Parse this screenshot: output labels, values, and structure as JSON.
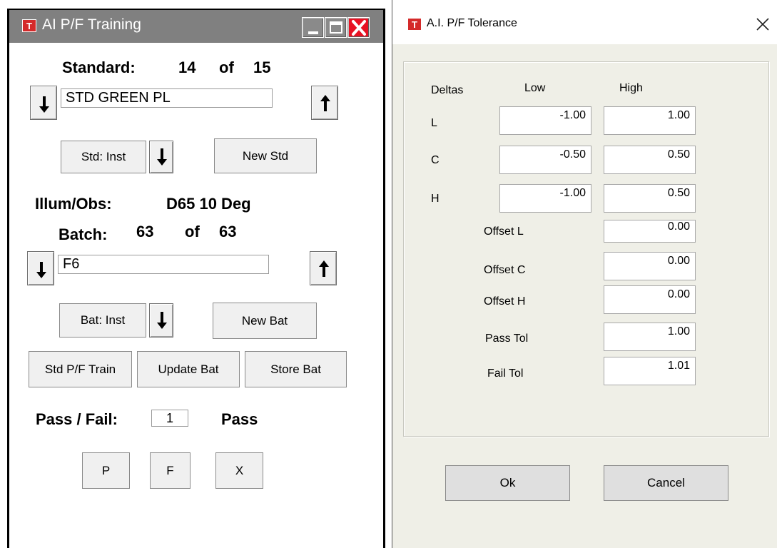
{
  "left_window": {
    "title": "AI P/F Training",
    "app_icon_text": "T",
    "standard": {
      "label": "Standard:",
      "current": "14",
      "of_label": "of",
      "total": "15",
      "name_value": "STD GREEN PL"
    },
    "std_inst_button": "Std: Inst",
    "new_std_button": "New Std",
    "illum_obs": {
      "label": "Illum/Obs:",
      "value": "D65 10 Deg"
    },
    "batch": {
      "label": "Batch:",
      "current": "63",
      "of_label": "of",
      "total": "63",
      "name_value": "F6"
    },
    "bat_inst_button": "Bat: Inst",
    "new_bat_button": "New Bat",
    "std_pf_train_button": "Std P/F Train",
    "update_bat_button": "Update Bat",
    "store_bat_button": "Store Bat",
    "pass_fail": {
      "label": "Pass / Fail:",
      "value": "1",
      "status": "Pass"
    },
    "p_button": "P",
    "f_button": "F",
    "x_button": "X"
  },
  "tolerance_dialog": {
    "title": "A.I. P/F Tolerance",
    "app_icon_text": "T",
    "headers": {
      "deltas": "Deltas",
      "low": "Low",
      "high": "High"
    },
    "rows": [
      {
        "label": "L",
        "low": "-1.00",
        "high": "1.00"
      },
      {
        "label": "C",
        "low": "-0.50",
        "high": "0.50"
      },
      {
        "label": "H",
        "low": "-1.00",
        "high": "0.50"
      }
    ],
    "offset_l": {
      "label": "Offset L",
      "value": "0.00"
    },
    "offset_c": {
      "label": "Offset C",
      "value": "0.00"
    },
    "offset_h": {
      "label": "Offset H",
      "value": "0.00"
    },
    "pass_tol": {
      "label": "Pass Tol",
      "value": "1.00"
    },
    "fail_tol": {
      "label": "Fail Tol",
      "value": "1.01"
    },
    "ok_button": "Ok",
    "cancel_button": "Cancel"
  },
  "colors": {
    "left_titlebar": "#808080",
    "close_red": "#e81123",
    "dialog_bg": "#efefe7",
    "app_icon_red": "#d42a2a"
  }
}
